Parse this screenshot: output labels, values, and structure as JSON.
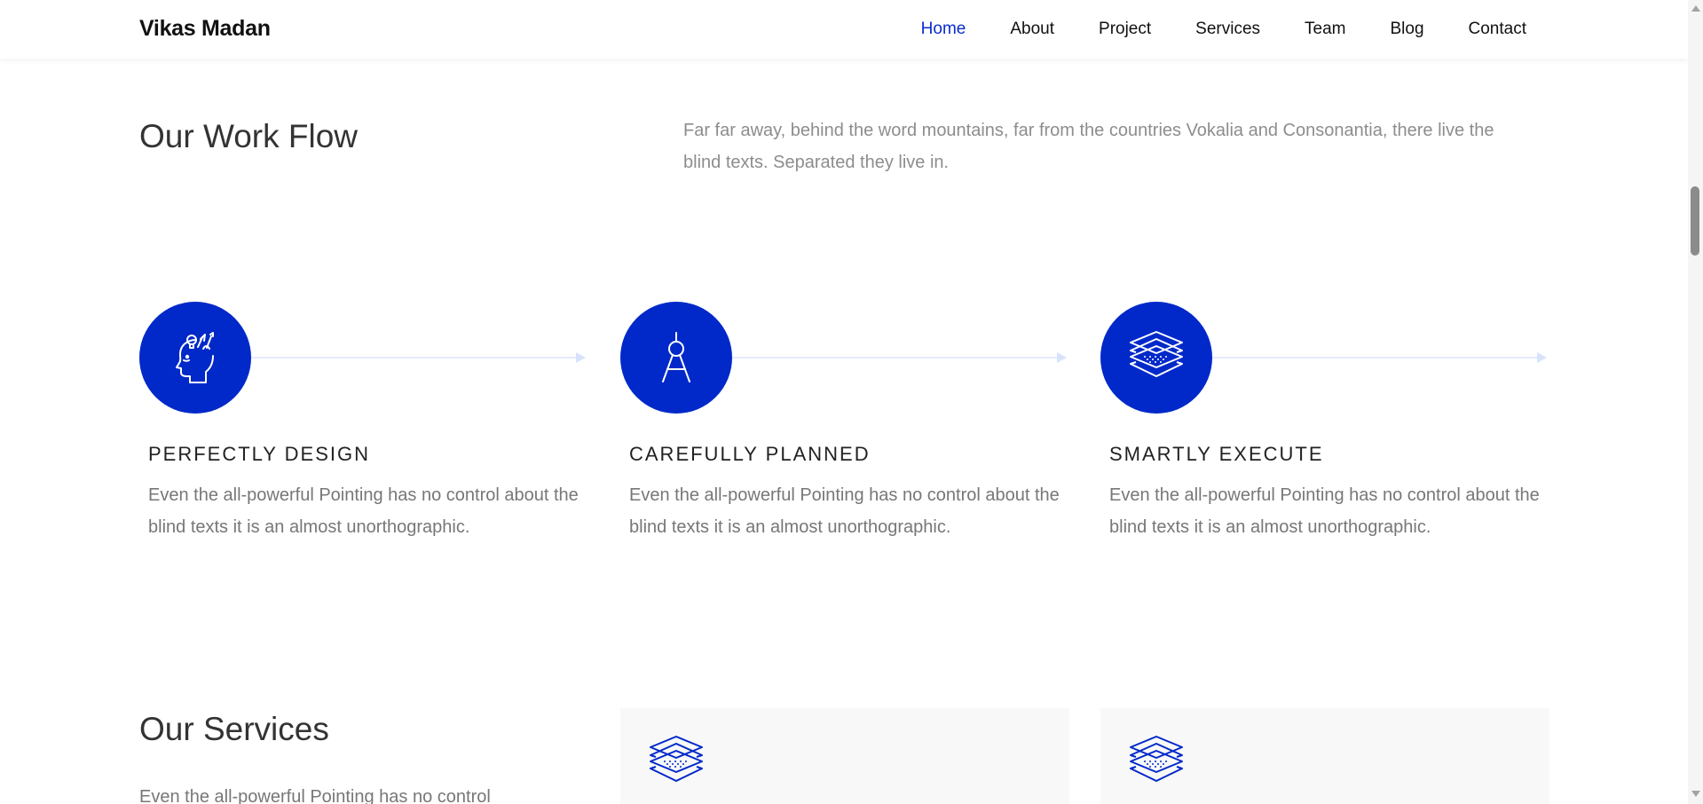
{
  "header": {
    "brand": "Vikas Madan",
    "nav": [
      {
        "label": "Home",
        "active": true
      },
      {
        "label": "About"
      },
      {
        "label": "Project"
      },
      {
        "label": "Services"
      },
      {
        "label": "Team"
      },
      {
        "label": "Blog"
      },
      {
        "label": "Contact"
      }
    ]
  },
  "workflow": {
    "title": "Our Work Flow",
    "intro": "Far far away, behind the word mountains, far from the countries Vokalia and Consonantia, there live the blind texts. Separated they live in.",
    "steps": [
      {
        "icon": "head-creative-icon",
        "title": "PERFECTLY DESIGN",
        "text": "Even the all-powerful Pointing has no control about the blind texts it is an almost unorthographic."
      },
      {
        "icon": "compass-drafting-icon",
        "title": "CAREFULLY PLANNED",
        "text": "Even the all-powerful Pointing has no control about the blind texts it is an almost unorthographic."
      },
      {
        "icon": "layers-icon",
        "title": "SMARTLY EXECUTE",
        "text": "Even the all-powerful Pointing has no control about the blind texts it is an almost unorthographic."
      }
    ]
  },
  "services": {
    "title": "Our Services",
    "text": "Even the all-powerful Pointing has no control",
    "cards": [
      {
        "icon": "layers-icon"
      },
      {
        "icon": "layers-icon"
      }
    ]
  },
  "colors": {
    "accent": "#0129c9",
    "active_nav": "#0a2ecc",
    "muted_text": "#8d8d8d",
    "card_background": "#f8f8f8"
  }
}
